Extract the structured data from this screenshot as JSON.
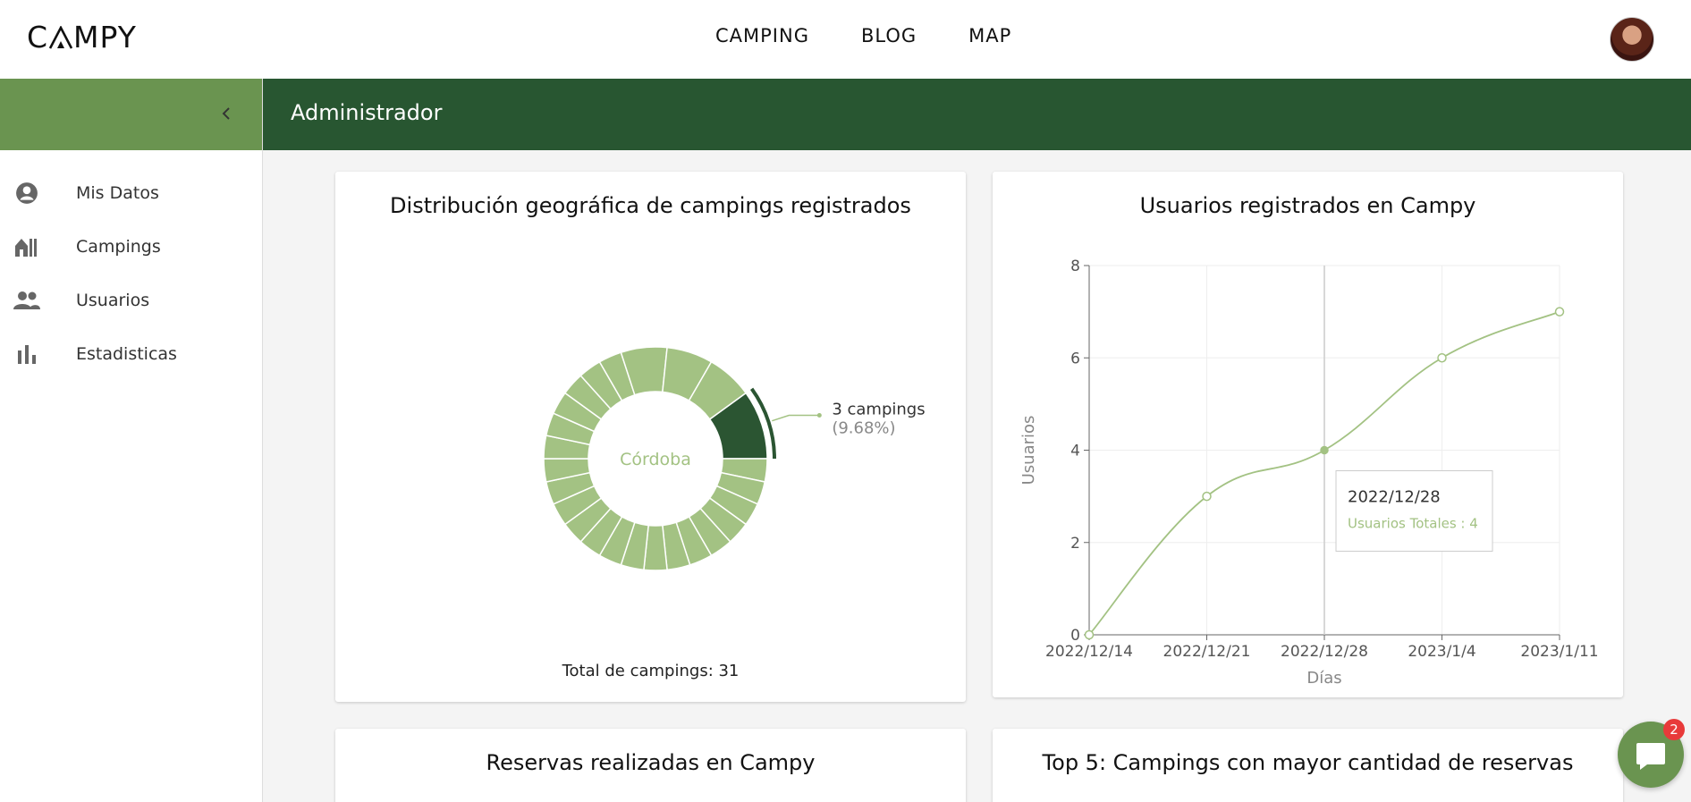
{
  "brand": {
    "logo_text_left": "C",
    "logo_text_right": "MPY"
  },
  "nav": {
    "items": [
      "CAMPING",
      "BLOG",
      "MAP"
    ]
  },
  "sidebar": {
    "items": [
      {
        "label": "Mis Datos",
        "icon": "account-circle-icon"
      },
      {
        "label": "Campings",
        "icon": "cabin-icon"
      },
      {
        "label": "Usuarios",
        "icon": "people-icon"
      },
      {
        "label": "Estadisticas",
        "icon": "bar-chart-icon"
      }
    ]
  },
  "header": {
    "title": "Administrador"
  },
  "colors": {
    "dark_green": "#285631",
    "light_green": "#6a9450",
    "chart_green": "#a3c283",
    "highlight_green": "#2b5532",
    "line_green": "#a3c283"
  },
  "cards": {
    "geo": {
      "title": "Distribución geográfica de campings registrados",
      "total": "Total de campings: 31"
    },
    "users": {
      "title": "Usuarios registrados en Campy"
    },
    "bookings": {
      "title": "Reservas realizadas en Campy"
    },
    "top5": {
      "title": "Top 5: Campings con mayor cantidad de reservas"
    }
  },
  "chart_data": [
    {
      "type": "pie",
      "title": "Distribución geográfica de campings registrados",
      "center_label": "Córdoba",
      "active_label": "3 campings",
      "active_percent": "(9.68%)",
      "slices": [
        {
          "name": "Córdoba",
          "value": 3
        },
        {
          "name": "",
          "value": 1
        },
        {
          "name": "",
          "value": 1
        },
        {
          "name": "",
          "value": 1
        },
        {
          "name": "",
          "value": 1
        },
        {
          "name": "",
          "value": 1
        },
        {
          "name": "",
          "value": 1
        },
        {
          "name": "",
          "value": 1
        },
        {
          "name": "",
          "value": 1
        },
        {
          "name": "",
          "value": 1
        },
        {
          "name": "",
          "value": 1
        },
        {
          "name": "",
          "value": 1
        },
        {
          "name": "",
          "value": 1
        },
        {
          "name": "",
          "value": 1
        },
        {
          "name": "",
          "value": 1
        },
        {
          "name": "",
          "value": 1
        },
        {
          "name": "",
          "value": 1
        },
        {
          "name": "",
          "value": 1
        },
        {
          "name": "",
          "value": 1
        },
        {
          "name": "",
          "value": 1
        },
        {
          "name": "",
          "value": 1
        },
        {
          "name": "",
          "value": 1
        },
        {
          "name": "",
          "value": 2
        },
        {
          "name": "",
          "value": 2
        },
        {
          "name": "",
          "value": 2
        }
      ]
    },
    {
      "type": "line",
      "title": "Usuarios registrados en Campy",
      "xlabel": "Días",
      "ylabel": "Usuarios",
      "categories": [
        "2022/12/14",
        "2022/12/21",
        "2022/12/28",
        "2023/1/4",
        "2023/1/11"
      ],
      "series": [
        {
          "name": "Usuarios Totales",
          "values": [
            0,
            3,
            4,
            6,
            7
          ]
        }
      ],
      "ylim": [
        0,
        8
      ],
      "yticks": [
        0,
        2,
        4,
        6,
        8
      ],
      "grid": true,
      "tooltip": {
        "title": "2022/12/28",
        "text": "Usuarios Totales : 4"
      }
    }
  ],
  "chat": {
    "badge": "2"
  }
}
